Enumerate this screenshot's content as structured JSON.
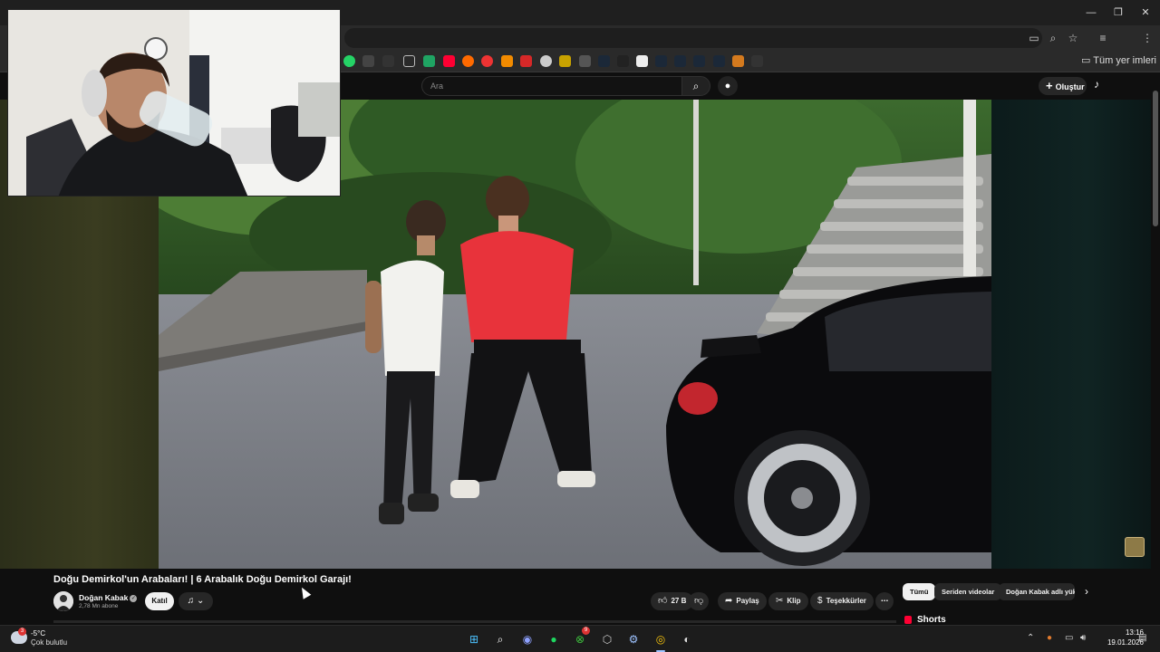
{
  "browser": {
    "window_controls": [
      "—",
      "❐",
      "✕"
    ],
    "toolbar_icons": [
      "cast-icon",
      "zoom-icon",
      "star-icon",
      "menu-icon"
    ],
    "bookmark_folder_label": "Tüm yer imleri"
  },
  "header": {
    "search_placeholder": "Ara",
    "create_label": "Oluştur"
  },
  "video": {
    "title": "Doğu Demirkol'un Arabaları! | 6 Arabalık Doğu Demirkol Garajı!",
    "channel_name": "Doğan Kabak",
    "subscribers": "2,78 Mn abone",
    "join_label": "Katıl",
    "like_count": "27 B",
    "share_label": "Paylaş",
    "clip_label": "Klip",
    "thanks_label": "Teşekkürler"
  },
  "chips": {
    "all": "Tümü",
    "series": "Seriden videolar",
    "channel": "Doğan Kabak adlı yüklemeler"
  },
  "shorts_label": "Shorts",
  "taskbar": {
    "weather_badge": "3",
    "temperature": "-5°C",
    "condition": "Çok bulutlu",
    "time": "13:16",
    "date": "19.01.2026",
    "xbox_badge": "9"
  },
  "colors": {
    "background": "#0f0f0f",
    "pill": "#272727",
    "brand_red": "#ff0033"
  }
}
